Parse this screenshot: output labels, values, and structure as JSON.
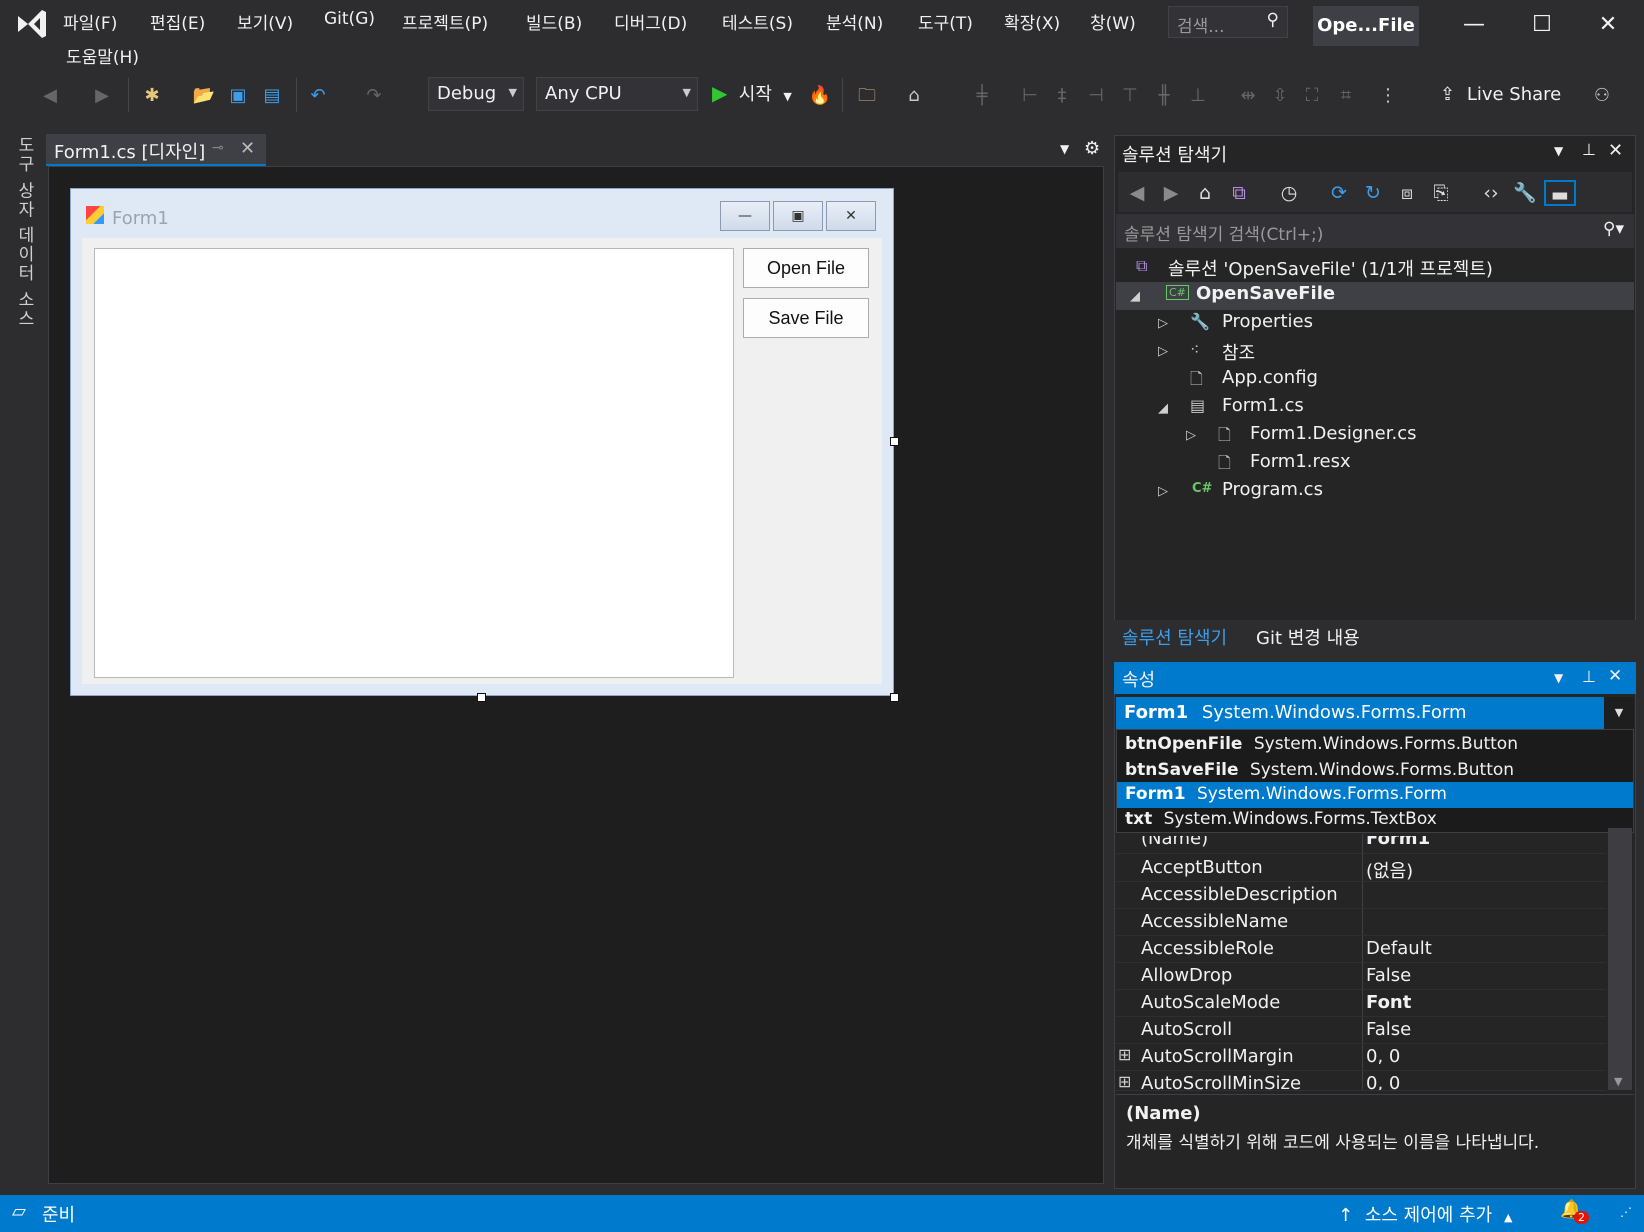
{
  "menu": {
    "items": [
      "파일(F)",
      "편집(E)",
      "보기(V)",
      "Git(G)",
      "프로젝트(P)",
      "빌드(B)",
      "디버그(D)",
      "테스트(S)",
      "분석(N)",
      "도구(T)",
      "확장(X)",
      "창(W)",
      "도움말(H)"
    ],
    "search_placeholder": "검색...",
    "title": "Ope...File"
  },
  "toolbar": {
    "config": "Debug",
    "platform": "Any CPU",
    "start_label": "시작",
    "live_share": "Live Share"
  },
  "left_tabs": {
    "toolbox": "도구 상자",
    "datasource": "데이터 소스"
  },
  "document": {
    "tab_label": "Form1.cs [디자인]"
  },
  "form": {
    "title": "Form1",
    "open_button": "Open File",
    "save_button": "Save File"
  },
  "solution_explorer": {
    "title": "솔루션 탐색기",
    "search_placeholder": "솔루션 탐색기 검색(Ctrl+;)",
    "solution": "솔루션 'OpenSaveFile' (1/1개 프로젝트)",
    "project": "OpenSaveFile",
    "items": {
      "properties": "Properties",
      "references": "참조",
      "appconfig": "App.config",
      "form1": "Form1.cs",
      "designer": "Form1.Designer.cs",
      "resx": "Form1.resx",
      "program": "Program.cs"
    },
    "tabs": [
      "솔루션 탐색기",
      "Git 변경 내용"
    ]
  },
  "properties": {
    "title": "속성",
    "selected_object": {
      "name": "Form1",
      "type": "System.Windows.Forms.Form"
    },
    "object_list": [
      {
        "name": "btnOpenFile",
        "type": "System.Windows.Forms.Button"
      },
      {
        "name": "btnSaveFile",
        "type": "System.Windows.Forms.Button"
      },
      {
        "name": "Form1",
        "type": "System.Windows.Forms.Form"
      },
      {
        "name": "txt",
        "type": "System.Windows.Forms.TextBox"
      }
    ],
    "rows": [
      {
        "name": "(Name)",
        "value": "Form1"
      },
      {
        "name": "AcceptButton",
        "value": "(없음)"
      },
      {
        "name": "AccessibleDescription",
        "value": ""
      },
      {
        "name": "AccessibleName",
        "value": ""
      },
      {
        "name": "AccessibleRole",
        "value": "Default"
      },
      {
        "name": "AllowDrop",
        "value": "False"
      },
      {
        "name": "AutoScaleMode",
        "value": "Font"
      },
      {
        "name": "AutoScroll",
        "value": "False"
      },
      {
        "name": "AutoScrollMargin",
        "value": "0, 0"
      },
      {
        "name": "AutoScrollMinSize",
        "value": "0, 0"
      }
    ],
    "desc_title": "(Name)",
    "desc_text": "개체를 식별하기 위해 코드에 사용되는 이름을 나타냅니다."
  },
  "status": {
    "ready": "준비",
    "source_control": "소스 제어에 추가",
    "notifications": "2"
  },
  "colors": {
    "accent": "#007acc",
    "background": "#2d2d30"
  }
}
